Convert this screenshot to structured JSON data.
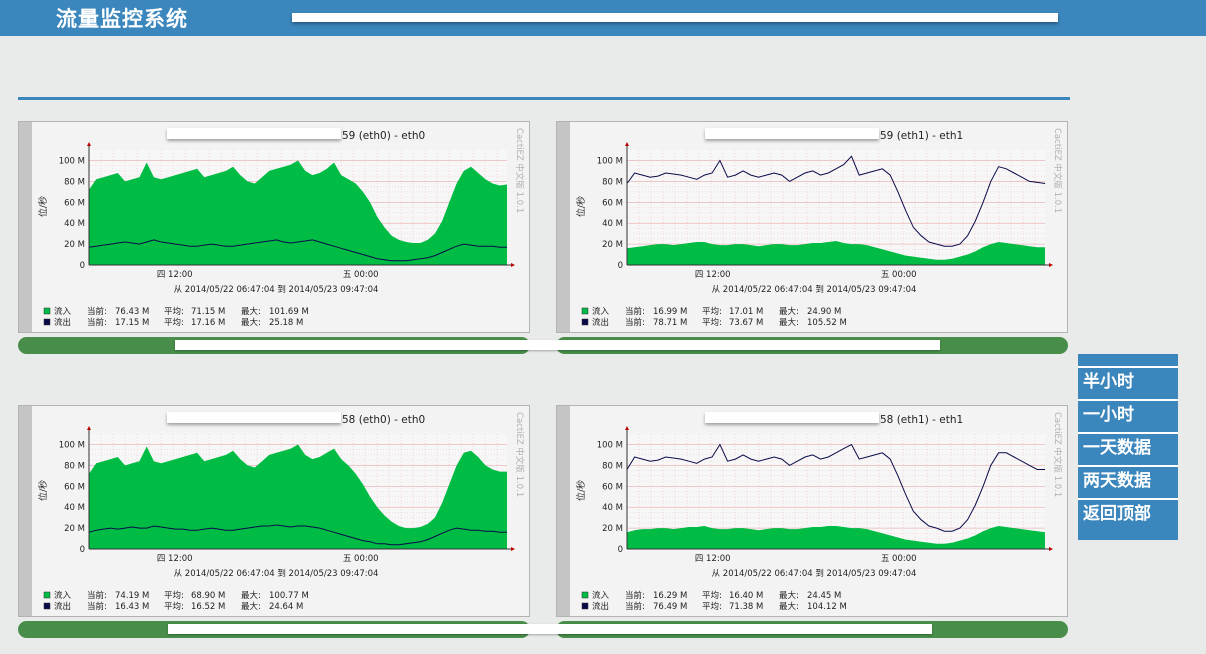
{
  "app": {
    "title": "流量监控系统"
  },
  "side_nav": [
    {
      "label": "半小时"
    },
    {
      "label": "一小时"
    },
    {
      "label": "一天数据"
    },
    {
      "label": "两天数据"
    },
    {
      "label": "返回顶部"
    }
  ],
  "graphs": [
    {
      "title_suffix": "59  (eth0) - eth0",
      "watermark": "CactiEZ 中文版 1.0.1",
      "ylabel": "位/秒",
      "yticks": [
        "100 M",
        "80 M",
        "60 M",
        "40 M",
        "20 M",
        "0"
      ],
      "xticks": [
        "四 12:00",
        "五 00:00"
      ],
      "range_text": "从 2014/05/22 06:47:04 到 2014/05/23 09:47:04",
      "legend": [
        {
          "name": "流入",
          "cur_label": "当前:",
          "cur": "76.43 M",
          "avg_label": "平均:",
          "avg": "71.15 M",
          "max_label": "最大:",
          "max": "101.69 M"
        },
        {
          "name": "流出",
          "cur_label": "当前:",
          "cur": "17.15 M",
          "avg_label": "平均:",
          "avg": "17.16 M",
          "max_label": "最大:",
          "max": "25.18 M"
        }
      ]
    },
    {
      "title_suffix": "59  (eth1) - eth1",
      "watermark": "CactiEZ 中文版 1.0.1",
      "ylabel": "位/秒",
      "yticks": [
        "100 M",
        "80 M",
        "60 M",
        "40 M",
        "20 M",
        "0"
      ],
      "xticks": [
        "四 12:00",
        "五 00:00"
      ],
      "range_text": "从 2014/05/22 06:47:04 到 2014/05/23 09:47:04",
      "legend": [
        {
          "name": "流入",
          "cur_label": "当前:",
          "cur": "16.99 M",
          "avg_label": "平均:",
          "avg": "17.01 M",
          "max_label": "最大:",
          "max": "24.90 M"
        },
        {
          "name": "流出",
          "cur_label": "当前:",
          "cur": "78.71 M",
          "avg_label": "平均:",
          "avg": "73.67 M",
          "max_label": "最大:",
          "max": "105.52 M"
        }
      ]
    },
    {
      "title_suffix": "58  (eth0) - eth0",
      "watermark": "CactiEZ 中文版 1.0.1",
      "ylabel": "位/秒",
      "yticks": [
        "100 M",
        "80 M",
        "60 M",
        "40 M",
        "20 M",
        "0"
      ],
      "xticks": [
        "四 12:00",
        "五 00:00"
      ],
      "range_text": "从 2014/05/22 06:47:04 到 2014/05/23 09:47:04",
      "legend": [
        {
          "name": "流入",
          "cur_label": "当前:",
          "cur": "74.19 M",
          "avg_label": "平均:",
          "avg": "68.90 M",
          "max_label": "最大:",
          "max": "100.77 M"
        },
        {
          "name": "流出",
          "cur_label": "当前:",
          "cur": "16.43 M",
          "avg_label": "平均:",
          "avg": "16.52 M",
          "max_label": "最大:",
          "max": "24.64 M"
        }
      ]
    },
    {
      "title_suffix": "58  (eth1) - eth1",
      "watermark": "CactiEZ 中文版 1.0.1",
      "ylabel": "位/秒",
      "yticks": [
        "100 M",
        "80 M",
        "60 M",
        "40 M",
        "20 M",
        "0"
      ],
      "xticks": [
        "四 12:00",
        "五 00:00"
      ],
      "range_text": "从 2014/05/22 06:47:04 到 2014/05/23 09:47:04",
      "legend": [
        {
          "name": "流入",
          "cur_label": "当前:",
          "cur": "16.29 M",
          "avg_label": "平均:",
          "avg": "16.40 M",
          "max_label": "最大:",
          "max": "24.45 M"
        },
        {
          "name": "流出",
          "cur_label": "当前:",
          "cur": "76.49 M",
          "avg_label": "平均:",
          "avg": "71.38 M",
          "max_label": "最大:",
          "max": "104.12 M"
        }
      ]
    }
  ],
  "chart_data": [
    {
      "type": "area",
      "ylim": [
        0,
        110
      ],
      "series": [
        {
          "name": "流入",
          "color": "#00bb44",
          "values": [
            72,
            82,
            84,
            86,
            88,
            80,
            82,
            84,
            98,
            84,
            82,
            84,
            86,
            88,
            90,
            92,
            84,
            86,
            88,
            90,
            94,
            86,
            80,
            78,
            84,
            90,
            92,
            94,
            96,
            100,
            90,
            86,
            88,
            92,
            98,
            86,
            82,
            78,
            70,
            60,
            46,
            36,
            28,
            24,
            22,
            21,
            21,
            24,
            30,
            42,
            60,
            78,
            90,
            94,
            88,
            82,
            78,
            76,
            77
          ]
        },
        {
          "name": "流出",
          "color": "#0a0a4a",
          "values": [
            17,
            18,
            19,
            20,
            21,
            22,
            21,
            20,
            22,
            24,
            22,
            21,
            20,
            19,
            18,
            18,
            19,
            20,
            19,
            18,
            18,
            19,
            20,
            21,
            22,
            23,
            24,
            22,
            21,
            22,
            23,
            24,
            22,
            20,
            18,
            16,
            14,
            12,
            10,
            8,
            6,
            5,
            4,
            4,
            4,
            5,
            6,
            7,
            9,
            12,
            15,
            18,
            20,
            19,
            18,
            18,
            18,
            17,
            17
          ]
        }
      ]
    },
    {
      "type": "area",
      "ylim": [
        0,
        110
      ],
      "series": [
        {
          "name": "流入",
          "color": "#00bb44",
          "values": [
            16,
            17,
            18,
            19,
            20,
            20,
            19,
            20,
            21,
            22,
            22,
            20,
            19,
            19,
            20,
            20,
            19,
            18,
            19,
            20,
            20,
            19,
            19,
            20,
            21,
            21,
            22,
            23,
            21,
            20,
            20,
            19,
            17,
            15,
            13,
            11,
            9,
            8,
            7,
            6,
            5,
            5,
            6,
            8,
            10,
            13,
            17,
            20,
            22,
            21,
            20,
            19,
            18,
            17,
            17
          ]
        },
        {
          "name": "流出",
          "color": "#0a0a4a",
          "values": [
            78,
            88,
            86,
            84,
            85,
            88,
            87,
            86,
            84,
            82,
            86,
            88,
            100,
            84,
            86,
            90,
            86,
            84,
            86,
            88,
            86,
            80,
            84,
            88,
            90,
            86,
            88,
            92,
            96,
            104,
            86,
            88,
            90,
            92,
            86,
            70,
            52,
            36,
            28,
            22,
            20,
            18,
            18,
            20,
            28,
            42,
            60,
            80,
            94,
            92,
            88,
            84,
            80,
            79,
            78
          ]
        }
      ]
    },
    {
      "type": "area",
      "ylim": [
        0,
        110
      ],
      "series": [
        {
          "name": "流入",
          "color": "#00bb44",
          "values": [
            72,
            82,
            84,
            86,
            88,
            80,
            82,
            84,
            98,
            84,
            82,
            84,
            86,
            88,
            90,
            92,
            84,
            86,
            88,
            90,
            94,
            86,
            80,
            78,
            84,
            90,
            92,
            94,
            96,
            100,
            90,
            86,
            88,
            92,
            96,
            86,
            80,
            72,
            62,
            50,
            40,
            32,
            26,
            22,
            20,
            20,
            21,
            24,
            30,
            44,
            62,
            80,
            92,
            94,
            88,
            80,
            76,
            74,
            74
          ]
        },
        {
          "name": "流出",
          "color": "#0a0a4a",
          "values": [
            16,
            18,
            19,
            20,
            19,
            20,
            21,
            20,
            20,
            22,
            21,
            20,
            19,
            19,
            18,
            18,
            19,
            20,
            19,
            18,
            18,
            19,
            20,
            21,
            22,
            22,
            23,
            22,
            21,
            22,
            22,
            21,
            20,
            18,
            16,
            14,
            12,
            10,
            8,
            7,
            5,
            5,
            4,
            4,
            5,
            6,
            7,
            9,
            12,
            15,
            18,
            20,
            19,
            18,
            18,
            17,
            17,
            16,
            16
          ]
        }
      ]
    },
    {
      "type": "area",
      "ylim": [
        0,
        110
      ],
      "series": [
        {
          "name": "流入",
          "color": "#00bb44",
          "values": [
            16,
            18,
            19,
            19,
            20,
            20,
            19,
            20,
            21,
            21,
            22,
            20,
            19,
            19,
            20,
            20,
            19,
            18,
            19,
            20,
            20,
            19,
            19,
            20,
            21,
            21,
            22,
            22,
            21,
            20,
            20,
            19,
            17,
            15,
            13,
            11,
            9,
            8,
            7,
            6,
            5,
            5,
            6,
            8,
            10,
            13,
            17,
            20,
            22,
            21,
            20,
            19,
            18,
            17,
            16
          ]
        },
        {
          "name": "流出",
          "color": "#0a0a4a",
          "values": [
            76,
            88,
            86,
            84,
            85,
            88,
            87,
            86,
            84,
            82,
            86,
            88,
            100,
            84,
            86,
            90,
            86,
            84,
            86,
            88,
            86,
            80,
            84,
            88,
            90,
            86,
            88,
            92,
            96,
            100,
            86,
            88,
            90,
            92,
            86,
            70,
            52,
            36,
            28,
            22,
            20,
            17,
            17,
            20,
            28,
            42,
            60,
            80,
            92,
            92,
            88,
            84,
            80,
            76,
            76
          ]
        }
      ]
    }
  ]
}
